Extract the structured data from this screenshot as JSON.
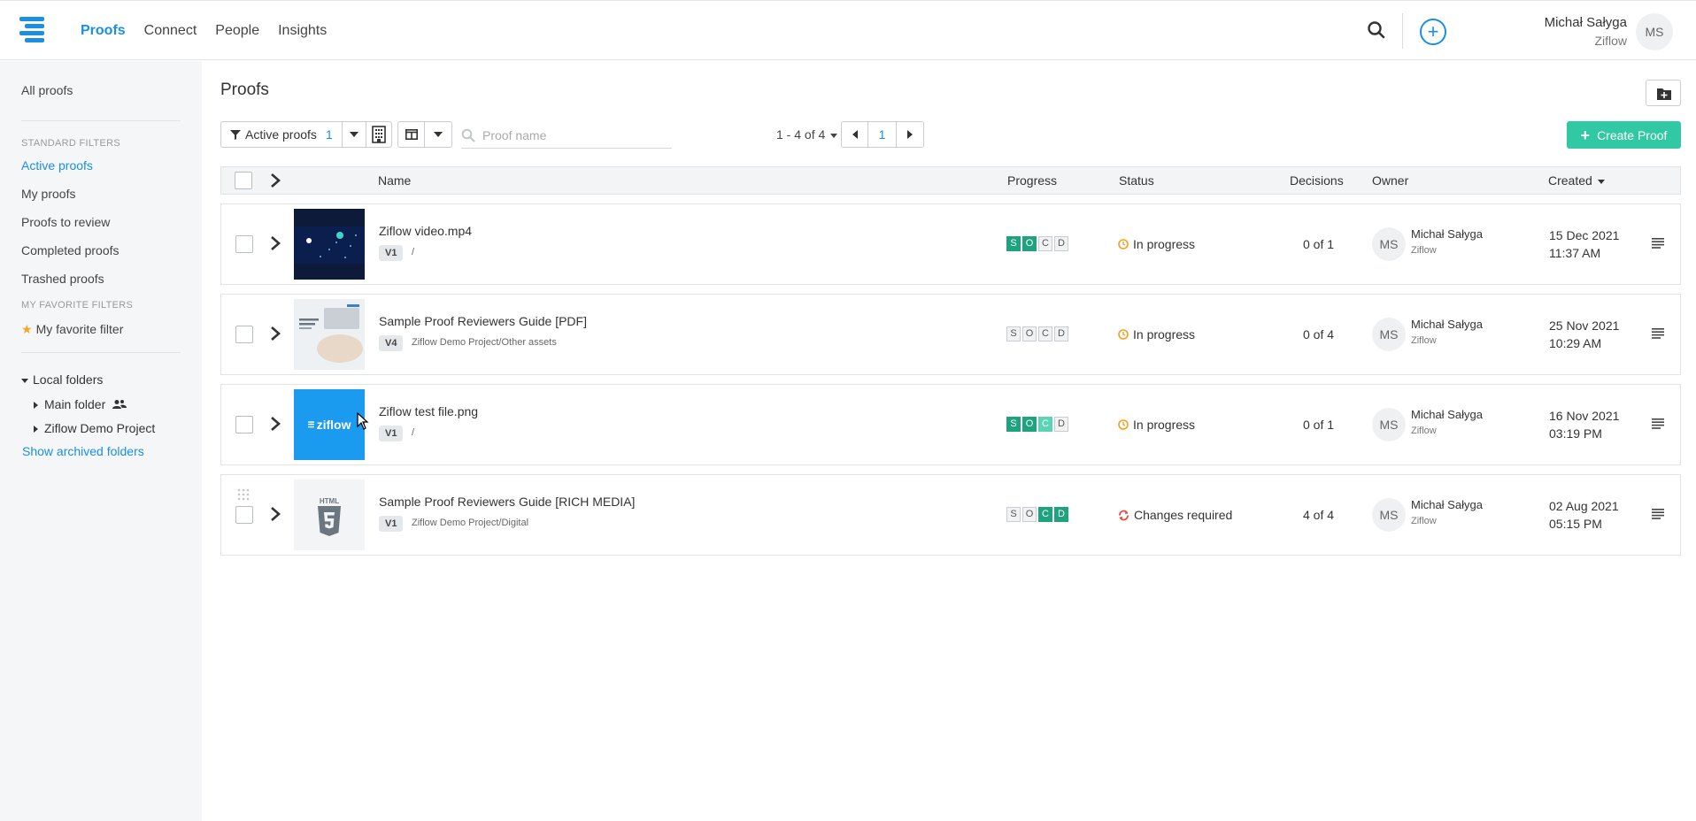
{
  "nav": {
    "items": [
      {
        "label": "Proofs",
        "active": true
      },
      {
        "label": "Connect",
        "active": false
      },
      {
        "label": "People",
        "active": false
      },
      {
        "label": "Insights",
        "active": false
      }
    ]
  },
  "user": {
    "name": "Michał Sałyga",
    "org": "Ziflow",
    "initials": "MS"
  },
  "icons": {
    "search": "search-icon",
    "add": "plus-circle-icon",
    "logo": "ziflow-logo-icon"
  },
  "colors": {
    "accent": "#1a8fe3",
    "create": "#30c9a3",
    "progress_done": "#1fa37f",
    "status_warn": "#f0a020",
    "status_changes": "#e84c3d"
  },
  "sidebar": {
    "all": "All proofs",
    "standard_heading": "STANDARD FILTERS",
    "filters": [
      "Active proofs",
      "My proofs",
      "Proofs to review",
      "Completed proofs",
      "Trashed proofs"
    ],
    "favorite_heading": "MY FAVORITE FILTERS",
    "favorite": "My favorite filter",
    "local_folders": "Local folders",
    "folders": [
      "Main folder",
      "Ziflow Demo Project"
    ],
    "archived": "Show archived folders"
  },
  "main": {
    "title": "Proofs",
    "filter_label": "Active proofs",
    "filter_count": "1",
    "search_placeholder": "Proof name",
    "range": "1 - 4 of 4",
    "page": "1",
    "create": "Create Proof"
  },
  "table": {
    "headers": {
      "name": "Name",
      "progress": "Progress",
      "status": "Status",
      "decisions": "Decisions",
      "owner": "Owner",
      "created": "Created"
    },
    "rows": [
      {
        "name": "Ziflow video.mp4",
        "version": "V1",
        "path": "/",
        "progress": [
          "done",
          "done",
          "off",
          "off"
        ],
        "status": "In progress",
        "status_kind": "warn",
        "decisions": "0 of 1",
        "owner_initials": "MS",
        "owner": "Michał Sałyga",
        "owner_org": "Ziflow",
        "date": "15 Dec 2021",
        "time": "11:37 AM"
      },
      {
        "name": "Sample Proof Reviewers Guide [PDF]",
        "version": "V4",
        "path": "Ziflow Demo Project/Other assets",
        "progress": [
          "off",
          "off",
          "off",
          "off"
        ],
        "status": "In progress",
        "status_kind": "warn",
        "decisions": "0 of 4",
        "owner_initials": "MS",
        "owner": "Michał Sałyga",
        "owner_org": "Ziflow",
        "date": "25 Nov 2021",
        "time": "10:29 AM"
      },
      {
        "name": "Ziflow test file.png",
        "version": "V1",
        "path": "/",
        "progress": [
          "done",
          "done",
          "light",
          "off"
        ],
        "status": "In progress",
        "status_kind": "warn",
        "decisions": "0 of 1",
        "owner_initials": "MS",
        "owner": "Michał Sałyga",
        "owner_org": "Ziflow",
        "date": "16 Nov 2021",
        "time": "03:19 PM",
        "thumb_text": "ziflow"
      },
      {
        "name": "Sample Proof Reviewers Guide [RICH MEDIA]",
        "version": "V1",
        "path": "Ziflow Demo Project/Digital",
        "progress": [
          "off",
          "off",
          "done",
          "done"
        ],
        "status": "Changes required",
        "status_kind": "changes",
        "decisions": "4 of 4",
        "owner_initials": "MS",
        "owner": "Michał Sałyga",
        "owner_org": "Ziflow",
        "date": "02 Aug 2021",
        "time": "05:15 PM",
        "thumb_text": "HTML"
      }
    ]
  },
  "progress_letters": [
    "S",
    "O",
    "C",
    "D"
  ]
}
